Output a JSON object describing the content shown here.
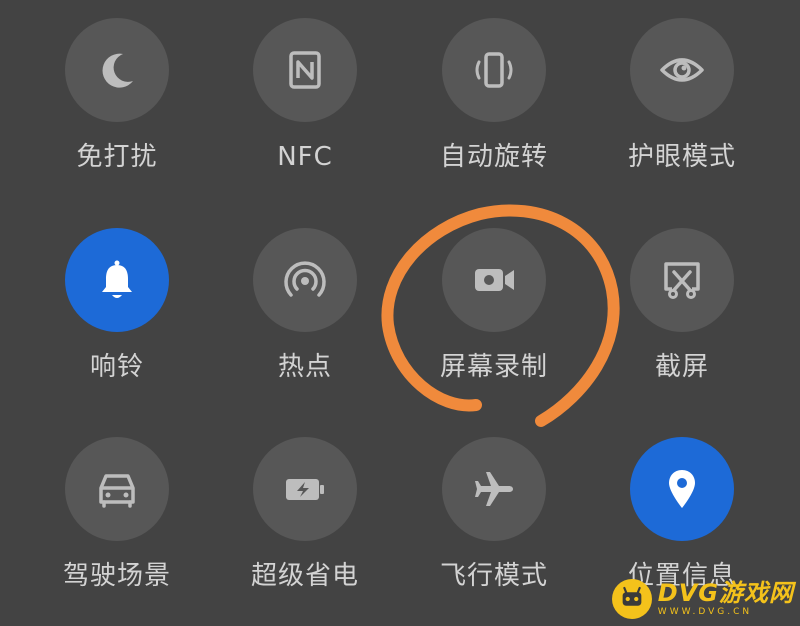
{
  "colors": {
    "panel_bg": "#434343",
    "tile_bg": "#575757",
    "tile_active_bg": "#1d6ad7",
    "icon": "#bdbdbd",
    "label": "#d3d3d3",
    "annotation": "#f08a3c",
    "watermark": "#f4c21b"
  },
  "tiles": [
    {
      "label": "免打扰",
      "icon": "moon-icon",
      "active": false
    },
    {
      "label": "NFC",
      "icon": "nfc-icon",
      "active": false
    },
    {
      "label": "自动旋转",
      "icon": "auto-rotate-icon",
      "active": false
    },
    {
      "label": "护眼模式",
      "icon": "eye-icon",
      "active": false
    },
    {
      "label": "响铃",
      "icon": "bell-icon",
      "active": true
    },
    {
      "label": "热点",
      "icon": "hotspot-icon",
      "active": false
    },
    {
      "label": "屏幕录制",
      "icon": "video-camera-icon",
      "active": false
    },
    {
      "label": "截屏",
      "icon": "screenshot-icon",
      "active": false
    },
    {
      "label": "驾驶场景",
      "icon": "car-icon",
      "active": false
    },
    {
      "label": "超级省电",
      "icon": "battery-saver-icon",
      "active": false
    },
    {
      "label": "飞行模式",
      "icon": "airplane-icon",
      "active": false
    },
    {
      "label": "位置信息",
      "icon": "location-pin-icon",
      "active": true
    }
  ],
  "watermark": {
    "title": "DVG游戏网",
    "url": "WWW.DVG.CN"
  }
}
